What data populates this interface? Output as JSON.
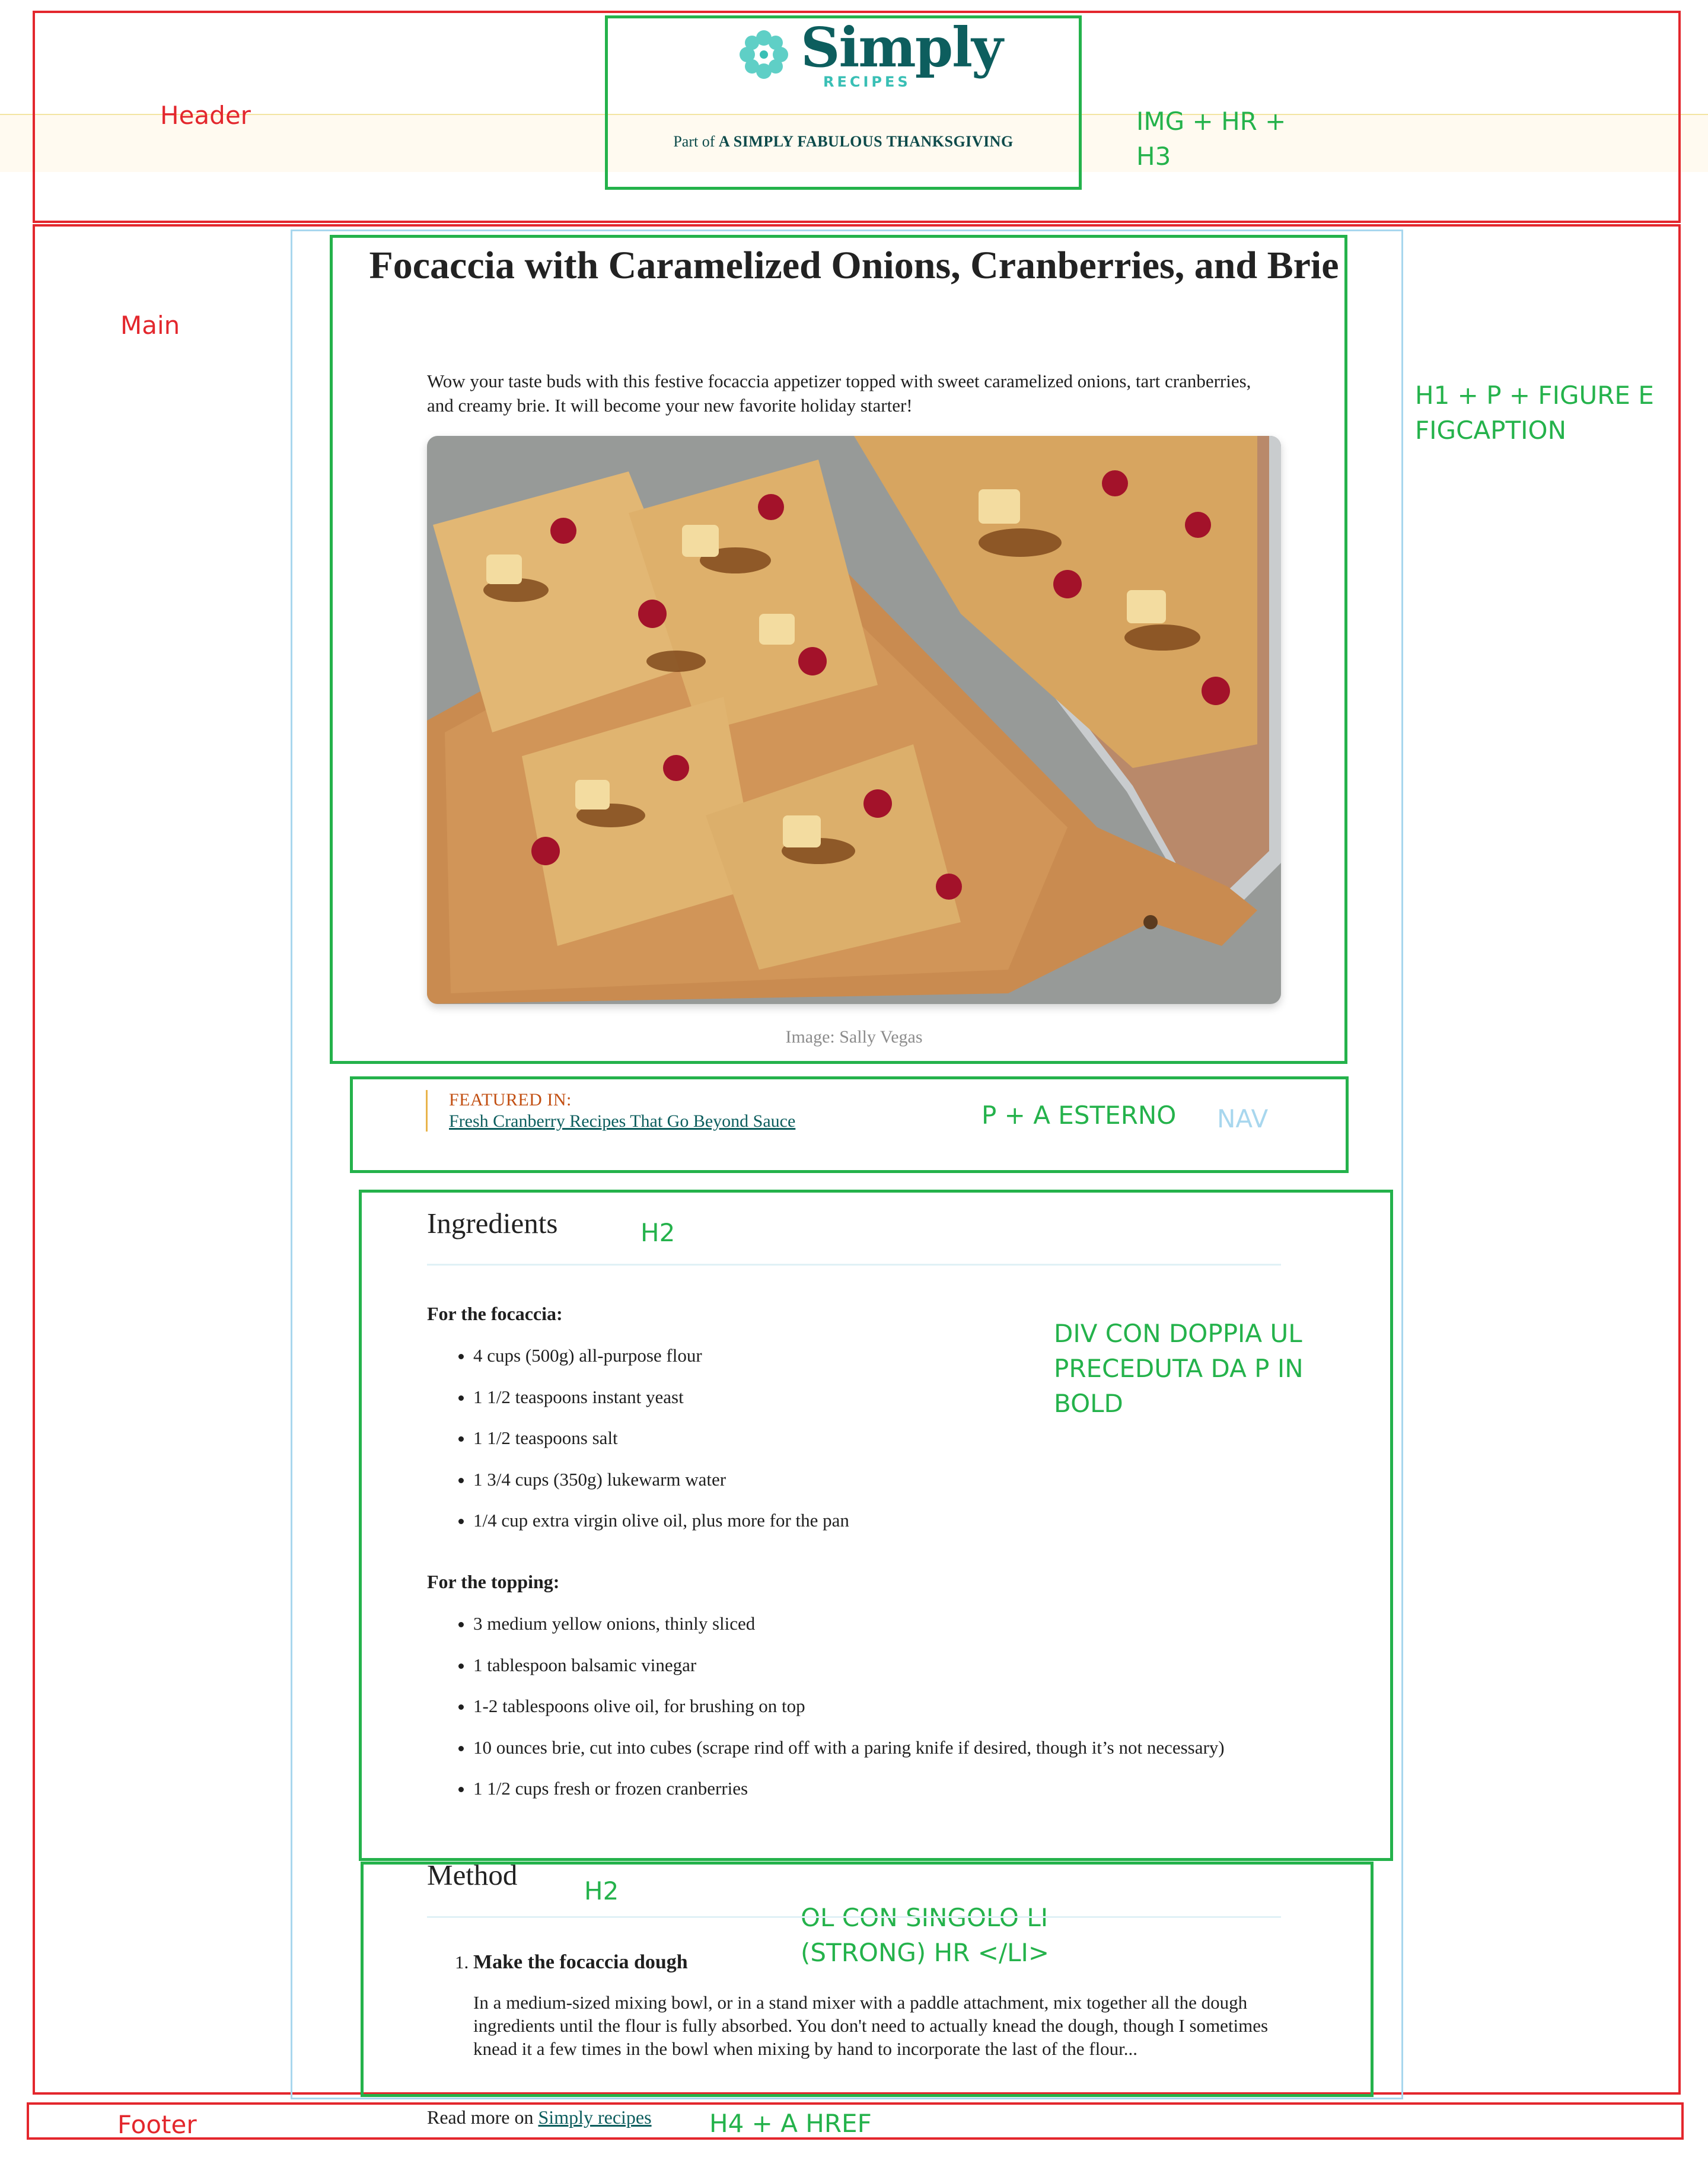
{
  "annotations": {
    "header": "Header",
    "header_note": "IMG + HR +\nH3",
    "main": "Main",
    "main_note": "H1 + P + FIGURE E\nFIGCAPTION",
    "nav": "NAV",
    "featured_note": "P + A ESTERNO",
    "ingredients_h2": "H2",
    "ingredients_note": "DIV CON DOPPIA UL\nPRECEDUTA DA P IN\nBOLD",
    "method_h2": "H2",
    "method_note": "OL CON SINGOLO LI\n(STRONG) HR </LI>",
    "footer": "Footer",
    "footer_note": "H4 + A HREF"
  },
  "header": {
    "logo_word": "Simply",
    "logo_sub": "RECIPES",
    "part_of_prefix": "Part of",
    "part_of_title": "A SIMPLY FABULOUS THANKSGIVING"
  },
  "recipe": {
    "title": "Focaccia with Caramelized Onions, Cranberries, and Brie",
    "intro": "Wow your taste buds with this festive focaccia appetizer topped with sweet caramelized onions, tart cranberries, and creamy brie. It will become your new favorite holiday starter!",
    "image_caption": "Image: Sally Vegas"
  },
  "featured": {
    "label": "FEATURED IN:",
    "link": "Fresh Cranberry Recipes That Go Beyond Sauce"
  },
  "ingredients": {
    "heading": "Ingredients",
    "focaccia_heading": "For the focaccia:",
    "focaccia": [
      "4 cups (500g) all-purpose flour",
      "1 1/2 teaspoons instant yeast",
      "1 1/2 teaspoons salt",
      "1 3/4 cups (350g) lukewarm water",
      "1/4 cup extra virgin olive oil, plus more for the pan"
    ],
    "topping_heading": "For the topping:",
    "topping": [
      "3 medium yellow onions, thinly sliced",
      "1 tablespoon balsamic vinegar",
      "1-2 tablespoons olive oil, for brushing on top",
      "10 ounces brie, cut into cubes (scrape rind off with a paring knife if desired, though it’s not necessary)",
      "1 1/2 cups fresh or frozen cranberries"
    ]
  },
  "method": {
    "heading": "Method",
    "step1_title": "Make the focaccia dough",
    "step1_text": "In a medium-sized mixing bowl, or in a stand mixer with a paddle attachment, mix together all the dough ingredients until the flour is fully absorbed. You don't need to actually knead the dough, though I sometimes knead it a few times in the bowl when mixing by hand to incorporate the last of the flour..."
  },
  "footer": {
    "prefix": "Read more on",
    "link": "Simply recipes"
  },
  "colors": {
    "annotation_red": "#e3272d",
    "annotation_green": "#24b24b",
    "annotation_blue": "#a8d7ee",
    "brand_teal": "#0d5e5e",
    "brand_aqua": "#39bfb5",
    "featured_orange": "#c24f12"
  }
}
